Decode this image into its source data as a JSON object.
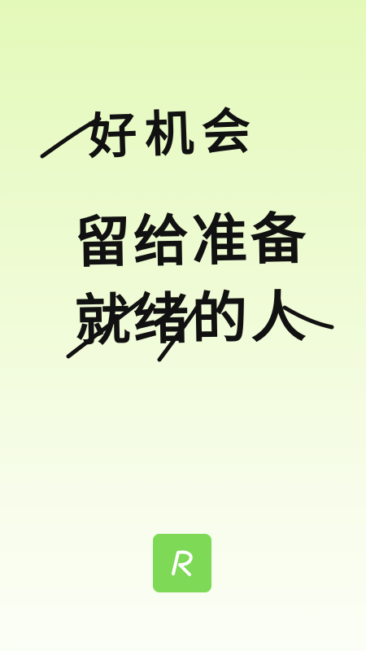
{
  "slogan": {
    "line_1": "好机会",
    "line_2": "留给准备",
    "line_3": "就绪的人"
  },
  "logo": {
    "icon": "r-logo-icon",
    "color": "#7ed957"
  },
  "colors": {
    "background_top": "#e3f9b9",
    "background_bottom": "#fbfef6",
    "text": "#111111"
  }
}
